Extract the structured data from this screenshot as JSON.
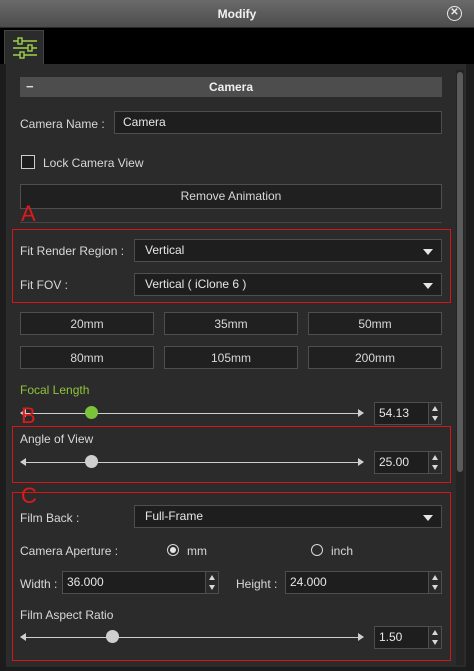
{
  "window": {
    "title": "Modify"
  },
  "section": {
    "title": "Camera"
  },
  "camera_name": {
    "label": "Camera Name :",
    "value": "Camera"
  },
  "lock_view": {
    "label": "Lock Camera View",
    "checked": false
  },
  "remove_animation": {
    "label": "Remove Animation"
  },
  "annotations": {
    "a": "A",
    "b": "B",
    "c": "C"
  },
  "fit_render_region": {
    "label": "Fit Render Region :",
    "value": "Vertical"
  },
  "fit_fov": {
    "label": "Fit FOV :",
    "value": "Vertical ( iClone 6 )"
  },
  "lens_presets": [
    "20mm",
    "35mm",
    "50mm",
    "80mm",
    "105mm",
    "200mm"
  ],
  "focal_length": {
    "label": "Focal Length",
    "value": "54.13"
  },
  "angle_of_view": {
    "label": "Angle of View",
    "value": "25.00"
  },
  "film_back": {
    "label": "Film Back :",
    "value": "Full-Frame"
  },
  "camera_aperture": {
    "label": "Camera Aperture :",
    "option_mm": "mm",
    "option_inch": "inch",
    "selected": "mm"
  },
  "width": {
    "label": "Width :",
    "value": "36.000"
  },
  "height": {
    "label": "Height :",
    "value": "24.000"
  },
  "film_aspect_ratio": {
    "label": "Film Aspect Ratio",
    "value": "1.50"
  },
  "colors": {
    "accent_green": "#8fc43a",
    "annotation_red": "#d41616",
    "panel_bg": "#2b2b2b"
  }
}
